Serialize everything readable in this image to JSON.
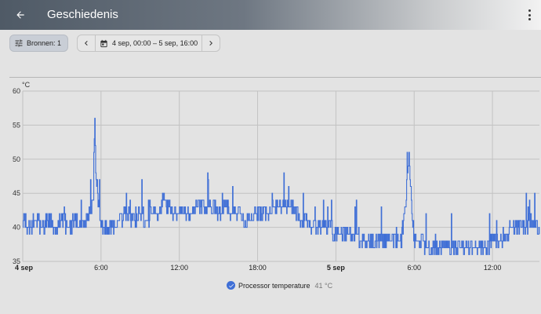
{
  "appbar": {
    "title": "Geschiedenis"
  },
  "toolbar": {
    "sources_label": "Bronnen: 1",
    "date_range": "4 sep, 00:00 – 5 sep, 16:00"
  },
  "colors": {
    "series": "#3f6fd6",
    "grid": "#c2c2c2",
    "background": "#e3e3e3"
  },
  "icons": [
    "arrow-back-icon",
    "more-vert-icon",
    "tune-icon",
    "chevron-left-icon",
    "calendar-icon",
    "chevron-right-icon",
    "check-circle-icon"
  ],
  "chart_data": {
    "type": "line",
    "ylabel": "°C",
    "ylim": [
      35,
      60
    ],
    "yticks": [
      "60",
      "55",
      "50",
      "45",
      "40",
      "35"
    ],
    "xticks": [
      "4 sep",
      "6:00",
      "12:00",
      "18:00",
      "5 sep",
      "6:00",
      "12:00"
    ],
    "xtick_hours": [
      0,
      6,
      12,
      18,
      24,
      30,
      36
    ],
    "x_unit": "hours since 4 sep 00:00",
    "xlim": [
      0,
      39.6
    ],
    "grid": true,
    "legend_placement": "bottom-center",
    "series": [
      {
        "name": "Processor temperature",
        "current_value": "41 °C",
        "x": [
          0,
          0.5,
          1,
          1.5,
          2,
          2.5,
          3,
          3.5,
          4,
          4.5,
          5,
          5.4,
          5.5,
          5.6,
          5.8,
          6,
          6.5,
          7,
          7.5,
          8,
          8.5,
          9,
          9.5,
          10,
          10.4,
          10.8,
          11,
          11.5,
          12,
          12.5,
          13,
          13.5,
          14,
          14.5,
          15,
          15.5,
          16,
          16.5,
          17,
          17.5,
          18,
          18.5,
          19,
          19.5,
          20,
          20.5,
          21,
          21.5,
          22,
          22.5,
          23,
          23.5,
          24,
          24.5,
          25,
          25.5,
          26,
          26.5,
          27,
          27.5,
          28,
          28.5,
          29,
          29.4,
          29.6,
          29.8,
          30,
          30.5,
          31,
          31.5,
          32,
          32.5,
          33,
          33.5,
          34,
          34.5,
          35,
          35.5,
          36,
          36.5,
          37,
          37.5,
          38,
          38.5,
          39,
          39.6
        ],
        "values": [
          41,
          40,
          41,
          40,
          41,
          40,
          41,
          40,
          41,
          40,
          41,
          44,
          57,
          48,
          43,
          40,
          40,
          40,
          41,
          42,
          41,
          42,
          41,
          42,
          42,
          44,
          43,
          42,
          42,
          42,
          42,
          43,
          43,
          43,
          42,
          43,
          42,
          42,
          41,
          41,
          42,
          42,
          42,
          43,
          43,
          43,
          42,
          41,
          40,
          40,
          40,
          40,
          39,
          39,
          39,
          39,
          38,
          38,
          38,
          38,
          38,
          38,
          38,
          45,
          51,
          44,
          38,
          38,
          37,
          37,
          37,
          37,
          37,
          37,
          37,
          37,
          37,
          37,
          38,
          38,
          39,
          40,
          40,
          40,
          41,
          40
        ]
      }
    ]
  }
}
